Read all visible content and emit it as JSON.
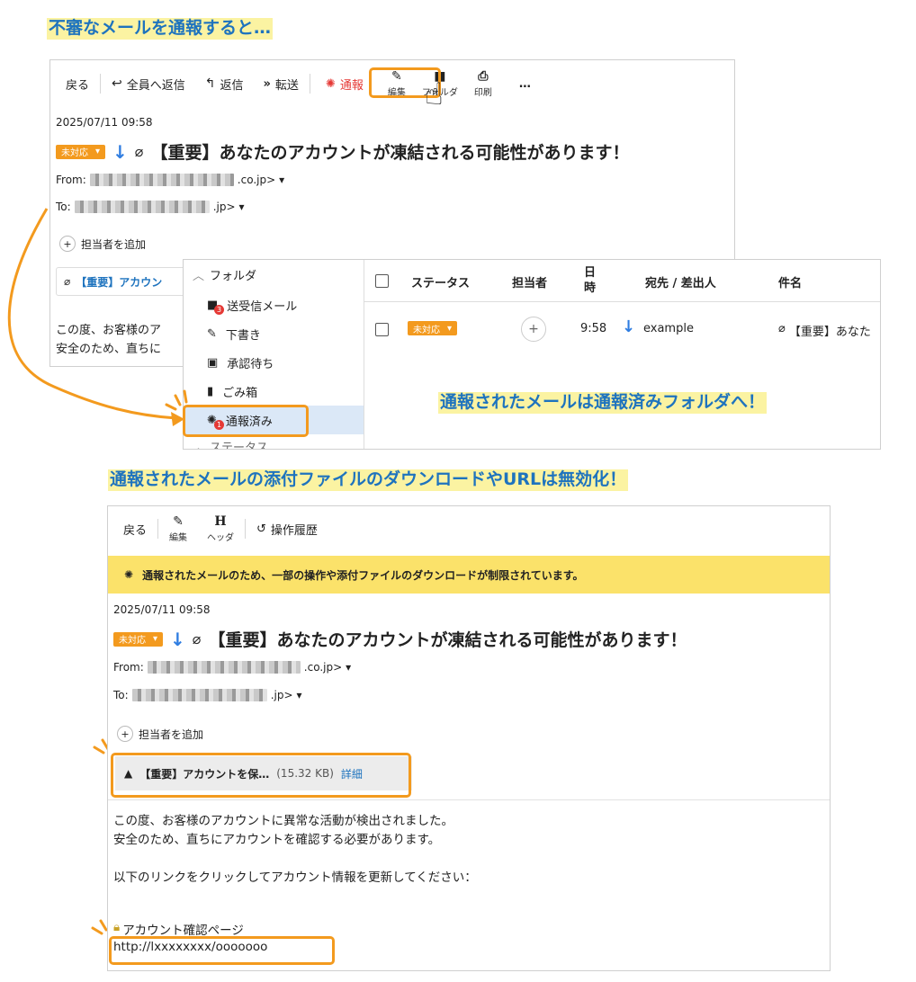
{
  "captions": {
    "top": "不審なメールを通報すると…",
    "middle": "通報されたメールは通報済みフォルダへ！",
    "bottom": "通報されたメールの添付ファイルのダウンロードやURLは無効化！"
  },
  "top_viewer": {
    "toolbar": {
      "back": "戻る",
      "reply_all": "全員へ返信",
      "reply": "返信",
      "forward": "転送",
      "report": "通報",
      "edit": "編集",
      "folder": "フォルダ",
      "print": "印刷",
      "more": "…"
    },
    "date": "2025/07/11 09:58",
    "status": "未対応",
    "subject": "【重要】あなたのアカウントが凍結される可能性があります！",
    "from_label": "From:",
    "from_domain": ".co.jp>",
    "to_label": "To:",
    "to_domain": ".jp>",
    "add_assignee": "担当者を追加",
    "attachment_partial": "【重要】アカウン",
    "body_partial": [
      "この度、お客様のア",
      "安全のため、直ちに"
    ]
  },
  "folder_panel": {
    "header": "フォルダ",
    "items": [
      {
        "label": "送受信メール",
        "icon": "folder-icon",
        "badge": "3"
      },
      {
        "label": "下書き",
        "icon": "pencil-icon"
      },
      {
        "label": "承認待ち",
        "icon": "approval-icon"
      },
      {
        "label": "ごみ箱",
        "icon": "trash-icon"
      },
      {
        "label": "通報済み",
        "icon": "alarm-icon",
        "badge": "1"
      }
    ],
    "next_section": "ステータス"
  },
  "mail_list": {
    "columns": [
      "ステータス",
      "担当者",
      "日時",
      "宛先 / 差出人",
      "件名"
    ],
    "rows": [
      {
        "status": "未対応",
        "assignee": "+",
        "time": "9:58",
        "sender": "example",
        "subject": "【重要】あなた"
      }
    ]
  },
  "bottom_viewer": {
    "toolbar": {
      "back": "戻る",
      "edit": "編集",
      "header": "ヘッダ",
      "header_glyph": "H",
      "history": "操作履歴"
    },
    "warning": "通報されたメールのため、一部の操作や添付ファイルのダウンロードが制限されています。",
    "date": "2025/07/11 09:58",
    "status": "未対応",
    "subject": "【重要】あなたのアカウントが凍結される可能性があります！",
    "from_label": "From:",
    "from_domain": ".co.jp>",
    "to_label": "To:",
    "to_domain": ".jp>",
    "add_assignee": "担当者を追加",
    "attachment": {
      "name": "【重要】アカウントを保…",
      "size": "(15.32 KB)",
      "detail": "詳細"
    },
    "body": [
      "この度、お客様のアカウントに異常な活動が検出されました。",
      "安全のため、直ちにアカウントを確認する必要があります。",
      "",
      "以下のリンクをクリックしてアカウント情報を更新してください："
    ],
    "link_label": "アカウント確認ページ",
    "link_url": "http://lxxxxxxxx/ooooooo"
  },
  "colors": {
    "accent_orange": "#f39a1e",
    "caption_blue": "#1e73be",
    "caption_bg": "#fbf3a2",
    "warning_bg": "#fbe26a",
    "report_red": "#e53935",
    "arrow_blue": "#2f7de1"
  }
}
